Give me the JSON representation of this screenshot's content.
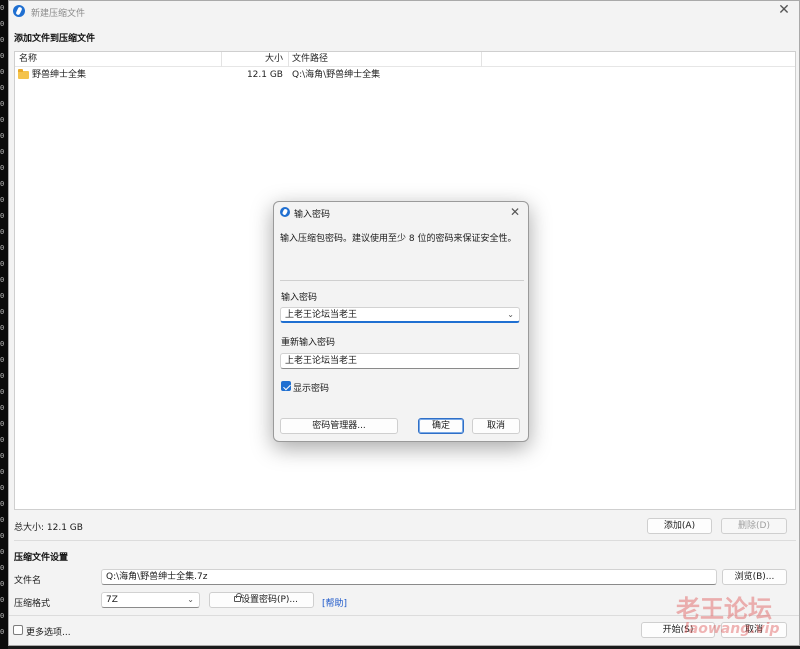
{
  "left_strip": [
    "0",
    "0",
    "0",
    "0",
    "0",
    "0",
    "0",
    "0",
    "0",
    "0",
    "0",
    "0",
    "0",
    "0",
    "0",
    "0",
    "0",
    "0",
    "0",
    "0",
    "0",
    "0",
    "0",
    "0",
    "0",
    "0",
    "0",
    "0",
    "0",
    "0",
    "0",
    "0",
    "0",
    "0",
    "0",
    "0",
    "0",
    "0",
    "0",
    "0"
  ],
  "window": {
    "title": "新建压缩文件",
    "section_add": "添加文件到压缩文件",
    "list": {
      "columns": [
        "名称",
        "大小",
        "文件路径"
      ],
      "rows": [
        {
          "name": "野兽绅士全集",
          "size": "12.1 GB",
          "path": "Q:\\海角\\野兽绅士全集"
        }
      ]
    },
    "total_size": "总大小: 12.1 GB",
    "add_button": "添加(A)",
    "delete_button": "删除(D)",
    "section_settings": "压缩文件设置",
    "filename_label": "文件名",
    "filename_value": "Q:\\海角\\野兽绅士全集.7z",
    "browse_button": "浏览(B)...",
    "format_label": "压缩格式",
    "format_value": "7Z",
    "set_password_button": "设置密码(P)...",
    "help_link": "[帮助]",
    "more_options": "更多选项...",
    "start_button": "开始(S)",
    "cancel_button": "取消"
  },
  "dialog": {
    "title": "输入密码",
    "description": "输入压缩包密码。建议使用至少 8 位的密码来保证安全性。",
    "password_label": "输入密码",
    "password_value": "上老王论坛当老王",
    "reenter_label": "重新输入密码",
    "reenter_value": "上老王论坛当老王",
    "show_password": "显示密码",
    "show_password_checked": true,
    "manager_button": "密码管理器...",
    "ok_button": "确定",
    "cancel_button": "取消"
  },
  "watermark": {
    "title": "老王论坛",
    "url": "laowang.vip"
  },
  "colors": {
    "accent": "#1f6fd1",
    "link": "#1a56c9",
    "watermark": "#e05a5a"
  }
}
